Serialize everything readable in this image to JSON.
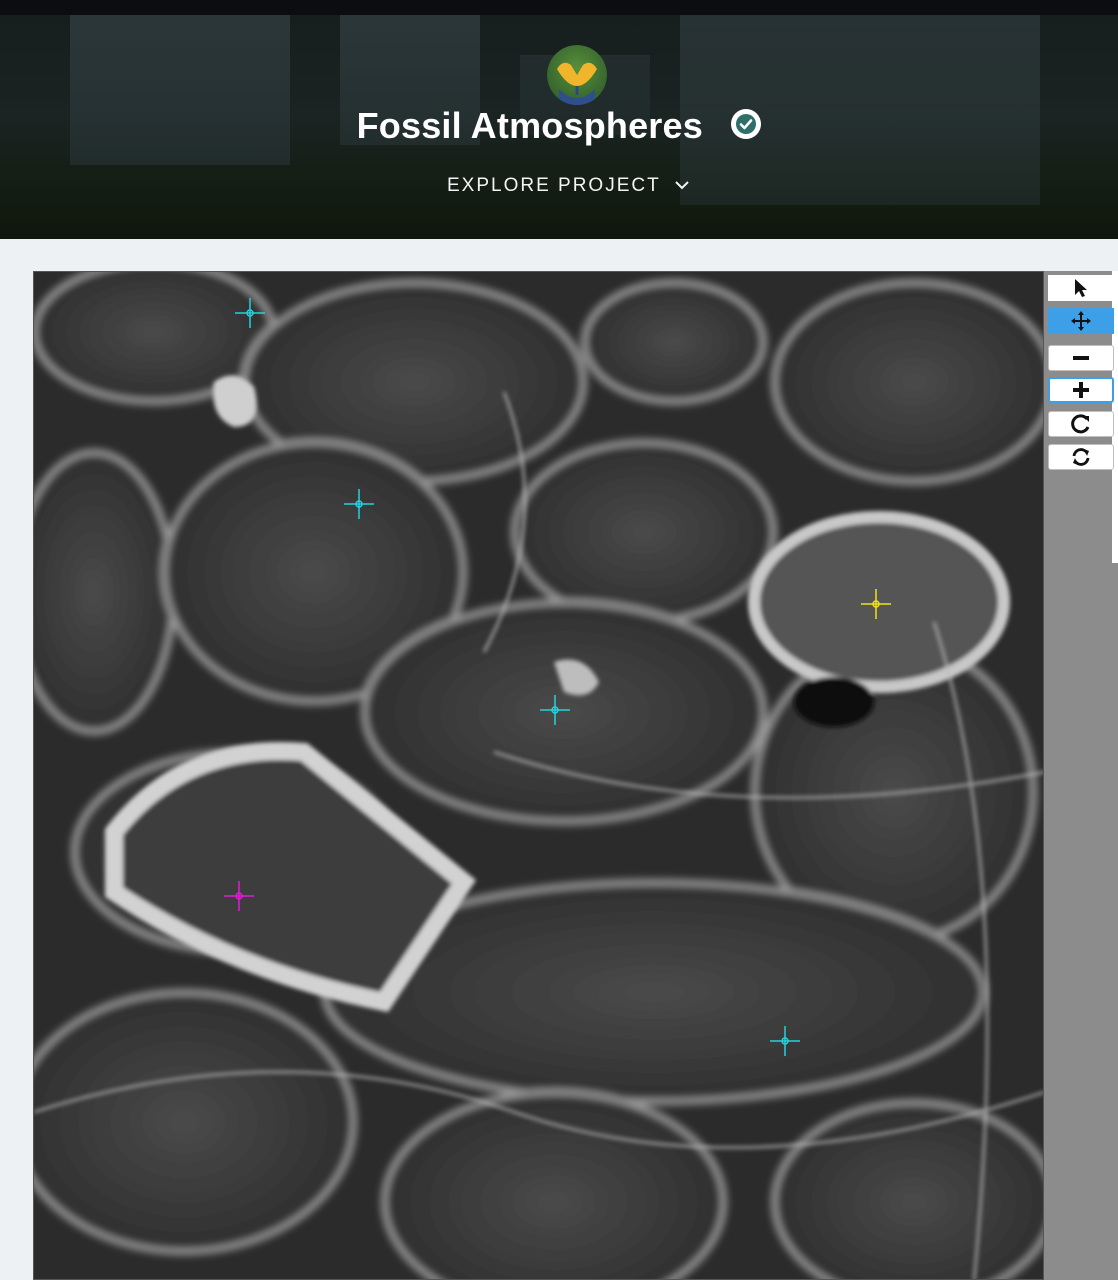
{
  "project": {
    "title": "Fossil Atmospheres",
    "verified": true,
    "explore_label": "EXPLORE PROJECT",
    "avatar_icon": "ginkgo-leaf-icon"
  },
  "viewer": {
    "image_description_icon": "leaf-cuticle-micrograph",
    "markers": [
      {
        "name": "marker-cyan-1",
        "color": "#22d3e0"
      },
      {
        "name": "marker-cyan-2",
        "color": "#22d3e0"
      },
      {
        "name": "marker-yellow-1",
        "color": "#f2e21a"
      },
      {
        "name": "marker-cyan-3",
        "color": "#22d3e0"
      },
      {
        "name": "marker-magenta-1",
        "color": "#e419d8"
      },
      {
        "name": "marker-cyan-4",
        "color": "#22d3e0"
      }
    ]
  },
  "toolbar": {
    "tools": [
      {
        "name": "select-tool-button",
        "icon": "pointer-arrow-icon",
        "state": "normal"
      },
      {
        "name": "pan-tool-button",
        "icon": "move-arrows-icon",
        "state": "active"
      },
      {
        "name": "zoom-out-button",
        "icon": "minus-icon",
        "state": "normal"
      },
      {
        "name": "zoom-in-button",
        "icon": "plus-icon",
        "state": "selected"
      },
      {
        "name": "rotate-button",
        "icon": "rotate-clockwise-icon",
        "state": "normal"
      },
      {
        "name": "reset-button",
        "icon": "refresh-icon",
        "state": "normal"
      }
    ]
  },
  "colors": {
    "accent": "#3d9fe8",
    "marker_cyan": "#22d3e0",
    "marker_yellow": "#f2e21a",
    "marker_magenta": "#e419d8"
  }
}
